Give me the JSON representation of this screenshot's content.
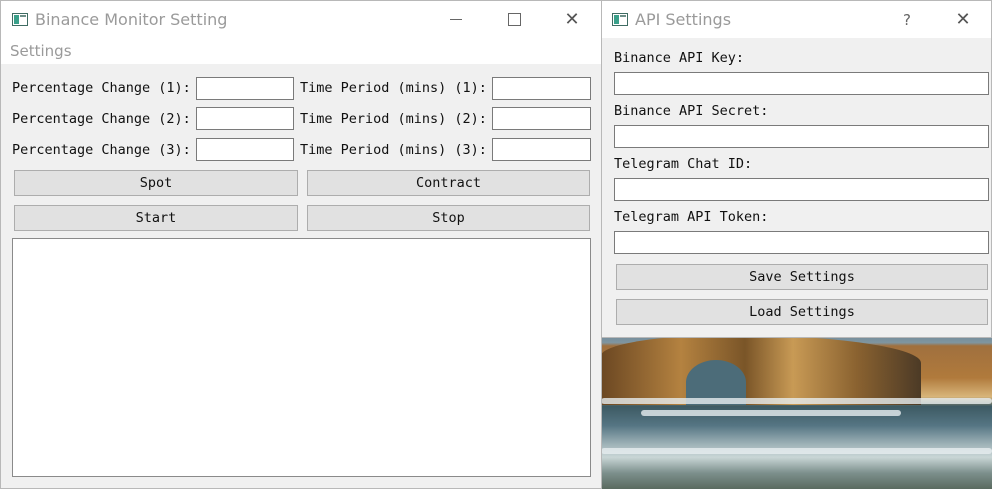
{
  "main_window": {
    "title": "Binance Monitor Setting",
    "menu": [
      "Settings"
    ],
    "rows": [
      {
        "pct_label": "Percentage Change (1):",
        "time_label": "Time Period (mins) (1):",
        "pct_value": "",
        "time_value": ""
      },
      {
        "pct_label": "Percentage Change (2):",
        "time_label": "Time Period (mins) (2):",
        "pct_value": "",
        "time_value": ""
      },
      {
        "pct_label": "Percentage Change (3):",
        "time_label": "Time Period (mins) (3):",
        "pct_value": "",
        "time_value": ""
      }
    ],
    "buttons": {
      "spot": "Spot",
      "contract": "Contract",
      "start": "Start",
      "stop": "Stop"
    },
    "log_text": ""
  },
  "api_window": {
    "title": "API Settings",
    "help": "?",
    "fields": [
      {
        "label": "Binance API Key:",
        "value": ""
      },
      {
        "label": "Binance API Secret:",
        "value": ""
      },
      {
        "label": "Telegram Chat ID:",
        "value": ""
      },
      {
        "label": "Telegram API Token:",
        "value": ""
      }
    ],
    "buttons": {
      "save": "Save Settings",
      "load": "Load Settings"
    }
  },
  "icons": {
    "app": "app-window-icon",
    "minimize": "minimize-icon",
    "maximize": "maximize-icon",
    "close": "close-icon",
    "help": "help-icon"
  },
  "colors": {
    "window_bg": "#f0f0f0",
    "titlebar_bg": "#ffffff",
    "title_text": "#9a9a9a",
    "button_bg": "#e1e1e1",
    "input_border": "#7a7a7a"
  }
}
